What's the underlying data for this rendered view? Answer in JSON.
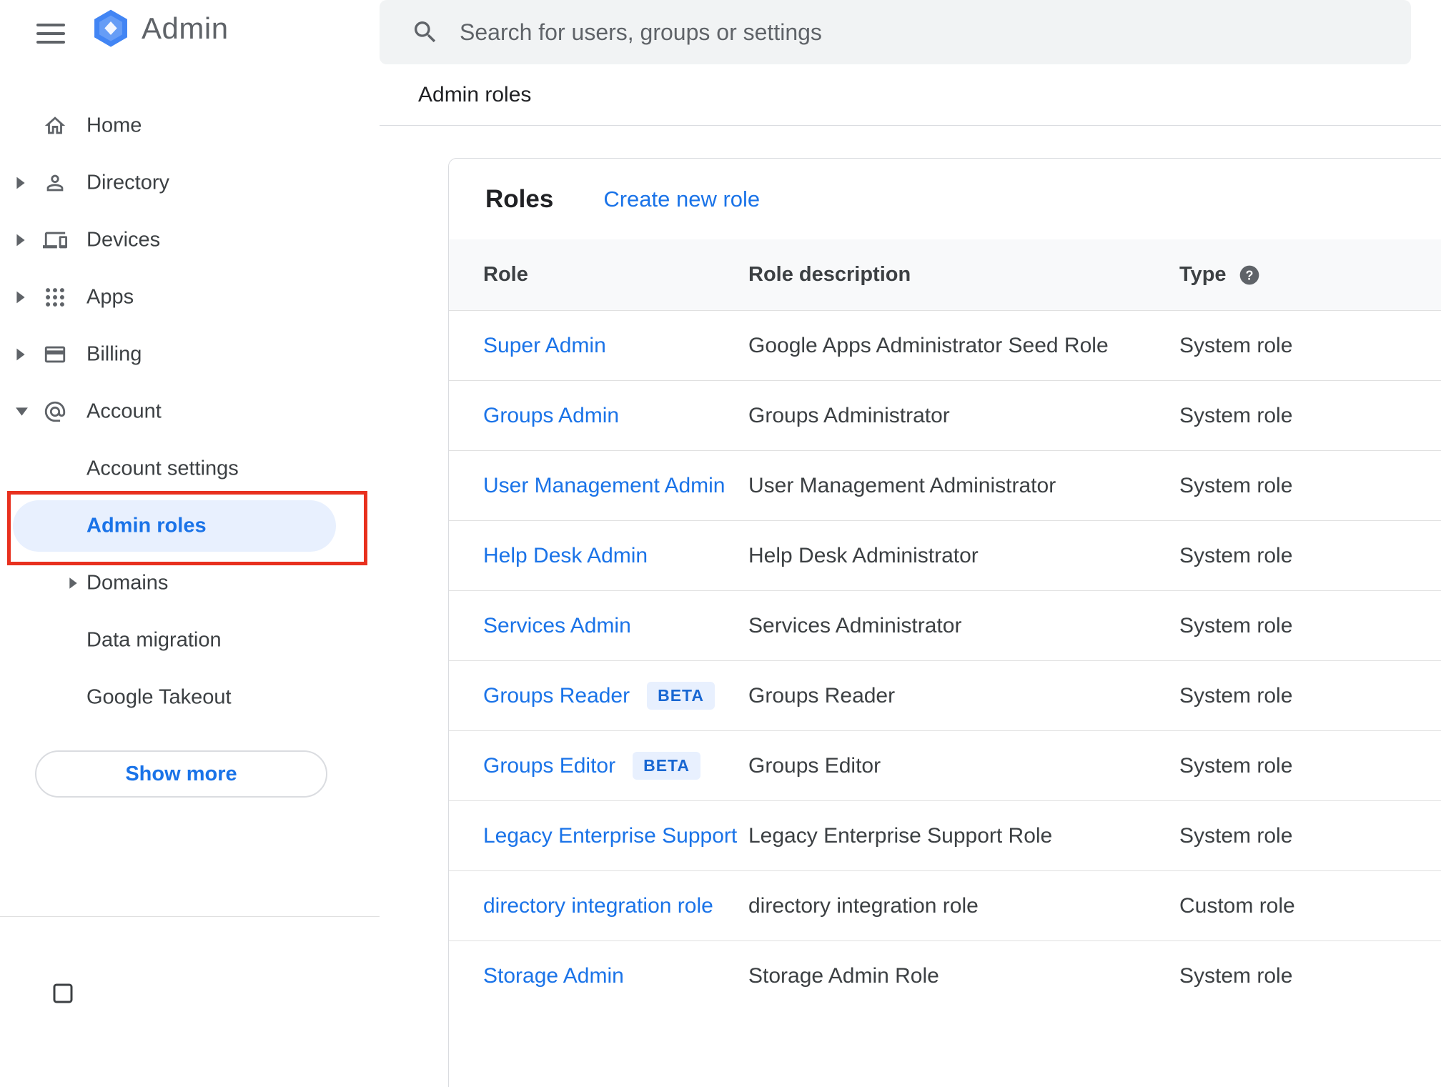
{
  "colors": {
    "accent_blue": "#1a73e8",
    "selected_item_bg": "#e8f0fe",
    "beta_badge_bg": "#e8f0fe",
    "beta_badge_text": "#1967d2",
    "annotation_red": "#e8301e",
    "text_primary": "#202124",
    "text_secondary": "#5f6368",
    "table_header_bg": "#f8f9fa"
  },
  "app": {
    "name": "Admin"
  },
  "topbar": {
    "search_placeholder": "Search for users, groups or settings"
  },
  "breadcrumb": {
    "label": "Admin roles"
  },
  "sidebar": {
    "items": [
      {
        "label": "Home",
        "icon": "home-icon",
        "expandable": false
      },
      {
        "label": "Directory",
        "icon": "directory-icon",
        "expandable": true
      },
      {
        "label": "Devices",
        "icon": "devices-icon",
        "expandable": true
      },
      {
        "label": "Apps",
        "icon": "apps-icon",
        "expandable": true
      },
      {
        "label": "Billing",
        "icon": "billing-icon",
        "expandable": true
      },
      {
        "label": "Account",
        "icon": "account-icon",
        "expandable": true,
        "expanded": true
      }
    ],
    "account_sub_items": [
      {
        "label": "Account settings",
        "selected": false
      },
      {
        "label": "Admin roles",
        "selected": true,
        "annotated": true
      },
      {
        "label": "Domains",
        "expandable": true
      },
      {
        "label": "Data migration"
      },
      {
        "label": "Google Takeout"
      }
    ],
    "show_more_label": "Show more"
  },
  "main": {
    "title": "Roles",
    "create_new_role_label": "Create new role",
    "table": {
      "columns": [
        "Role",
        "Role description",
        "Type"
      ],
      "beta_badge_label": "BETA",
      "rows": [
        {
          "role": "Super Admin",
          "beta": false,
          "description": "Google Apps Administrator Seed Role",
          "type": "System role"
        },
        {
          "role": "Groups Admin",
          "beta": false,
          "description": "Groups Administrator",
          "type": "System role"
        },
        {
          "role": "User Management Admin",
          "beta": false,
          "description": "User Management Administrator",
          "type": "System role"
        },
        {
          "role": "Help Desk Admin",
          "beta": false,
          "description": "Help Desk Administrator",
          "type": "System role"
        },
        {
          "role": "Services Admin",
          "beta": false,
          "description": "Services Administrator",
          "type": "System role"
        },
        {
          "role": "Groups Reader",
          "beta": true,
          "description": "Groups Reader",
          "type": "System role"
        },
        {
          "role": "Groups Editor",
          "beta": true,
          "description": "Groups Editor",
          "type": "System role"
        },
        {
          "role": "Legacy Enterprise Support",
          "beta": false,
          "description": "Legacy Enterprise Support Role",
          "type": "System role"
        },
        {
          "role": "directory integration role",
          "beta": false,
          "description": "directory integration role",
          "type": "Custom role"
        },
        {
          "role": "Storage Admin",
          "beta": false,
          "description": "Storage Admin Role",
          "type": "System role"
        }
      ]
    }
  }
}
